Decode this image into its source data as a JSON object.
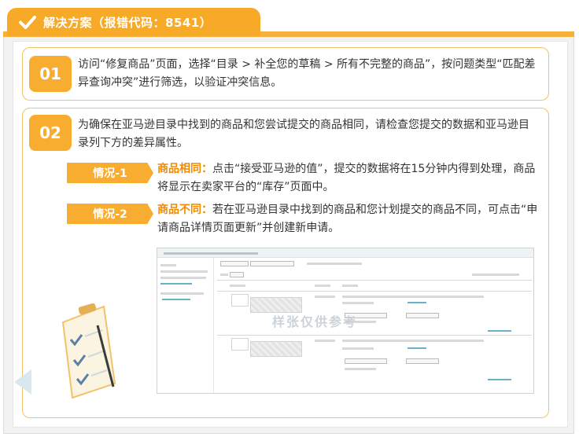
{
  "header": {
    "title": "解决方案（报错代码：8541）"
  },
  "steps": [
    {
      "number": "01",
      "text": "访问“修复商品”页面，选择“目录 > 补全您的草稿 > 所有不完整的商品”，按问题类型“匹配差异查询冲突”进行筛选，以验证冲突信息。"
    },
    {
      "number": "02",
      "text": "为确保在亚马逊目录中找到的商品和您尝试提交的商品相同，请检查您提交的数据和亚马逊目录列下方的差异属性。"
    }
  ],
  "cases": [
    {
      "label": "情况-1",
      "highlight": "商品相同：",
      "text": "点击“接受亚马逊的值”，提交的数据将在15分钟内得到处理，商品将显示在卖家平台的“库存”页面中。"
    },
    {
      "label": "情况-2",
      "highlight": "商品不同：",
      "text": "若在亚马逊目录中找到的商品和您计划提交的商品不同，可点击“申请商品详情页面更新”并创建新申请。"
    }
  ],
  "watermark": "样张仅供参考",
  "colors": {
    "accent": "#f8ad31",
    "highlight": "#f08a00"
  }
}
